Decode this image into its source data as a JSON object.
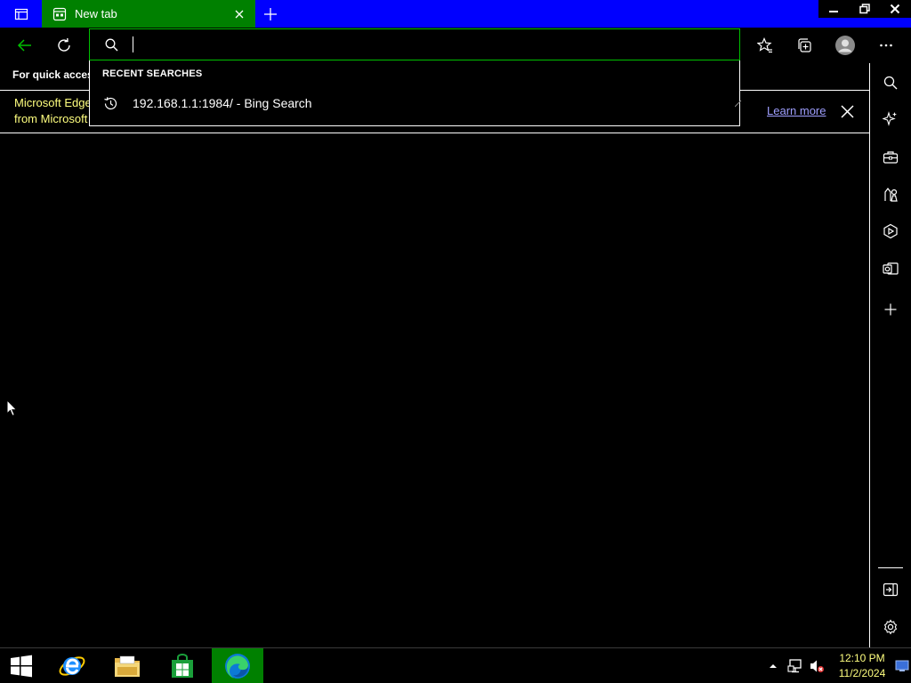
{
  "colors": {
    "titlebar": "#0000ff",
    "active_tab": "#008000",
    "accent_green": "#00c000",
    "infobar_text": "#ffff7f",
    "link": "#9f9fff"
  },
  "tab": {
    "title": "New tab",
    "icon": "newtab-page-icon"
  },
  "toolbar": {
    "back_icon": "arrow-left-icon",
    "refresh_icon": "refresh-icon",
    "favorites_icon": "star-list-icon",
    "collections_icon": "collections-icon",
    "profile_icon": "avatar",
    "menu_icon": "more-icon"
  },
  "favorites_bar": {
    "prompt": "For quick access"
  },
  "infobar": {
    "line1": "Microsoft Edge",
    "line2": "from Microsoft",
    "learn_more": "Learn more"
  },
  "omnibox": {
    "value": "",
    "recent_header": "RECENT SEARCHES",
    "recent": [
      {
        "text": "192.168.1.1:1984/ - Bing Search",
        "icon": "history-icon"
      }
    ]
  },
  "sidebar": {
    "items": [
      "search-icon",
      "copilot-icon",
      "tools-icon",
      "games-icon",
      "office-icon",
      "outlook-icon",
      "add-icon"
    ],
    "bottom": [
      "hide-sidebar-icon",
      "settings-icon"
    ]
  },
  "taskbar": {
    "apps": [
      "start-icon",
      "internet-explorer-icon",
      "file-explorer-icon",
      "store-icon",
      "edge-icon"
    ],
    "time": "12:10 PM",
    "date": "11/2/2024"
  }
}
